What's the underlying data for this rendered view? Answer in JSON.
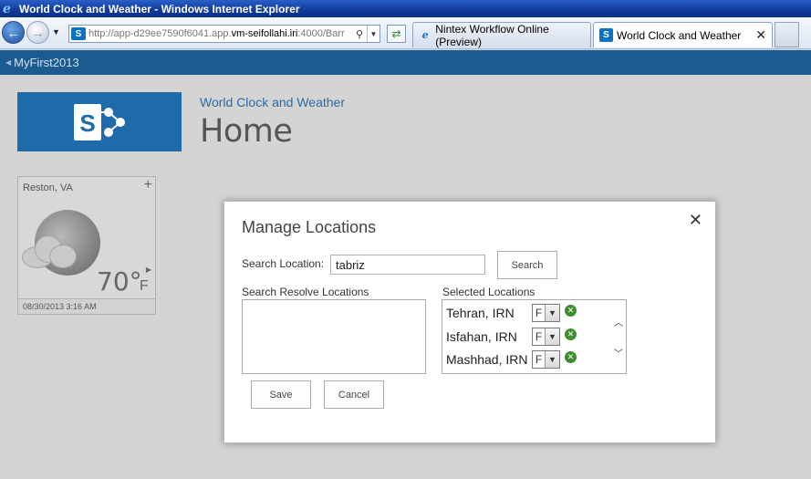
{
  "browser": {
    "title": "World Clock and Weather - Windows Internet Explorer",
    "url_prefix": "http://app-d29ee7590f6041.app.",
    "url_host": "vm-seifollahi.iri",
    "url_suffix": ":4000/Barr",
    "tabs": [
      {
        "label": "Nintex Workflow Online (Preview)"
      },
      {
        "label": "World Clock and Weather"
      }
    ]
  },
  "suitebar": {
    "back_label": "MyFirst2013"
  },
  "site": {
    "subtitle": "World Clock and Weather",
    "title": "Home"
  },
  "weather_tile": {
    "location": "Reston, VA",
    "add_symbol": "+",
    "temperature": "70°",
    "unit": "F",
    "datetime": "08/30/2013 3:16 AM",
    "condition_icon": "moon-cloud-icon"
  },
  "dialog": {
    "title": "Manage Locations",
    "search_label": "Search Location:",
    "search_value": "tabriz",
    "search_button": "Search",
    "resolve_label": "Search Resolve Locations",
    "selected_label": "Selected Locations",
    "selected": [
      {
        "city": "Tehran, IRN",
        "unit": "F"
      },
      {
        "city": "Isfahan, IRN",
        "unit": "F"
      },
      {
        "city": "Mashhad, IRN",
        "unit": "F"
      }
    ],
    "save_button": "Save",
    "cancel_button": "Cancel"
  },
  "colors": {
    "suitebar": "#1b5b8f",
    "logo_tile": "#1f6aa8",
    "remove_icon": "#3e8e2f"
  }
}
